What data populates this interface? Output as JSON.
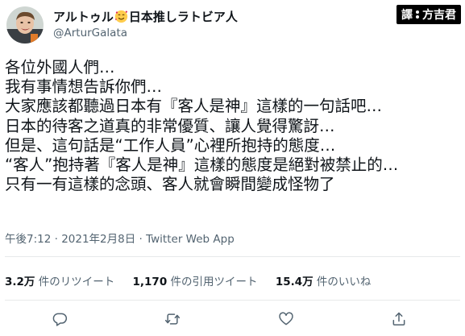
{
  "author": {
    "name_prefix": "アルトゥル",
    "name_suffix": "日本推しラトビア人",
    "handle": "@ArturGalata"
  },
  "badge": {
    "left": "譯",
    "right": "方吉君"
  },
  "tweet_lines": [
    "各位外國人們…",
    "我有事情想告訴你們…",
    "大家應該都聽過日本有『客人是神』這樣的一句話吧…",
    "日本的待客之道真的非常優質、讓人覺得驚訝…",
    "但是、這句話是“工作人員”心裡所抱持的態度…",
    "“客人”抱持著『客人是神』這樣的態度是絕對被禁止的…",
    "只有一有這樣的念頭、客人就會瞬間變成怪物了"
  ],
  "meta": {
    "time": "午後7:12",
    "separator1": " · ",
    "date": "2021年2月8日",
    "separator2": " · ",
    "source": "Twitter Web App"
  },
  "stats": {
    "retweets_count": "3.2万",
    "retweets_label": " 件のリツイート",
    "quotes_count": "1,170",
    "quotes_label": " 件の引用ツイート",
    "likes_count": "15.4万",
    "likes_label": " 件のいいね"
  },
  "icons": {
    "reply": "reply-icon",
    "retweet": "retweet-icon",
    "like": "heart-icon",
    "share": "share-icon"
  }
}
